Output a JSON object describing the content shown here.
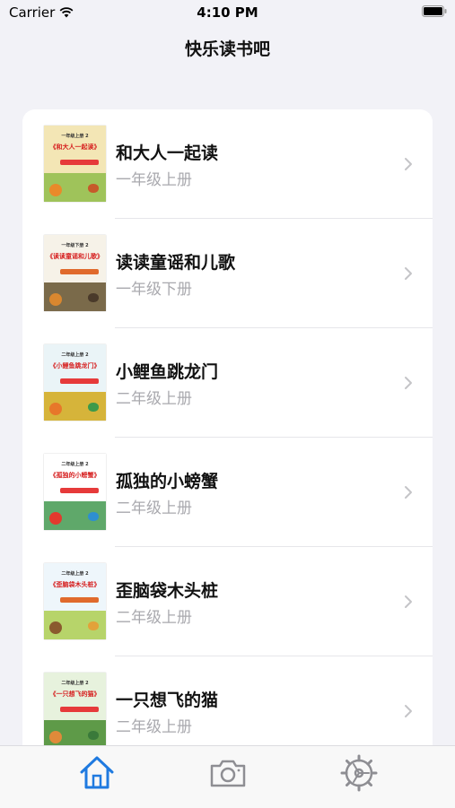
{
  "status_bar": {
    "carrier": "Carrier",
    "time": "4:10 PM"
  },
  "nav": {
    "title": "快乐读书吧"
  },
  "books": [
    {
      "title": "和大人一起读",
      "grade": "一年级上册",
      "cover_grade": "一年级上册 2",
      "cover_title": "《和大人一起读》",
      "cover_sky": "#f3e6b5",
      "cover_ground": "#9fc35a",
      "cover_badge": "#e63a3a"
    },
    {
      "title": "读读童谣和儿歌",
      "grade": "一年级下册",
      "cover_grade": "一年级下册 2",
      "cover_title": "《读读童谣和儿歌》",
      "cover_sky": "#f6f2e8",
      "cover_ground": "#7a6a4a",
      "cover_badge": "#e06a2c"
    },
    {
      "title": "小鲤鱼跳龙门",
      "grade": "二年级上册",
      "cover_grade": "二年级上册 2",
      "cover_title": "《小鲤鱼跳龙门》",
      "cover_sky": "#eaf4f7",
      "cover_ground": "#d6b43a",
      "cover_badge": "#e63a3a"
    },
    {
      "title": "孤独的小螃蟹",
      "grade": "二年级上册",
      "cover_grade": "二年级上册 2",
      "cover_title": "《孤独的小螃蟹》",
      "cover_sky": "#ffffff",
      "cover_ground": "#5fa86a",
      "cover_badge": "#e63a3a"
    },
    {
      "title": "歪脑袋木头桩",
      "grade": "二年级上册",
      "cover_grade": "二年级上册 2",
      "cover_title": "《歪脑袋木头桩》",
      "cover_sky": "#eef6fb",
      "cover_ground": "#b7d46a",
      "cover_badge": "#e06a2c"
    },
    {
      "title": "一只想飞的猫",
      "grade": "二年级上册",
      "cover_grade": "二年级上册 2",
      "cover_title": "《一只想飞的猫》",
      "cover_sky": "#e7f2dd",
      "cover_ground": "#5e9a48",
      "cover_badge": "#e63a3a"
    }
  ],
  "tabs": [
    {
      "icon": "house-icon",
      "active": true
    },
    {
      "icon": "camera-icon",
      "active": false
    },
    {
      "icon": "gear-icon",
      "active": false
    }
  ],
  "colors": {
    "accent": "#1f7ae0",
    "inactive": "#8e8e93",
    "background": "#f2f2f7"
  }
}
